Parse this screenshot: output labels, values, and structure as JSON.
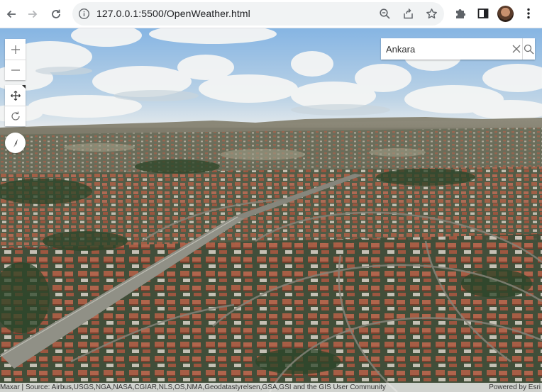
{
  "browser": {
    "url_host": "127.0.0.1",
    "url_rest": ":5500/OpenWeather.html"
  },
  "search": {
    "value": "Ankara"
  },
  "attribution": {
    "source": "Maxar | Source: Airbus,USGS,NGA,NASA,CGIAR,NLS,OS,NMA,Geodatastyrelsen,GSA,GSI and the GIS User Community",
    "powered": "Powered by Esri"
  },
  "colors": {
    "sky_top": "#8fb9e0",
    "sky_bottom": "#dfe8ee",
    "terrain_far": "#8c8878",
    "terrain_mid": "#6a6c58",
    "roof": "#b6664a",
    "vegetation": "#3f5a35"
  },
  "icons": {
    "back": "arrow-left-icon",
    "forward": "arrow-right-icon",
    "reload": "reload-icon",
    "info": "info-icon",
    "zoom": "magnifier-icon",
    "share": "share-icon",
    "bookmark": "star-icon",
    "extensions": "puzzle-icon",
    "sidepanel": "side-panel-icon",
    "menu": "kebab-menu-icon"
  }
}
